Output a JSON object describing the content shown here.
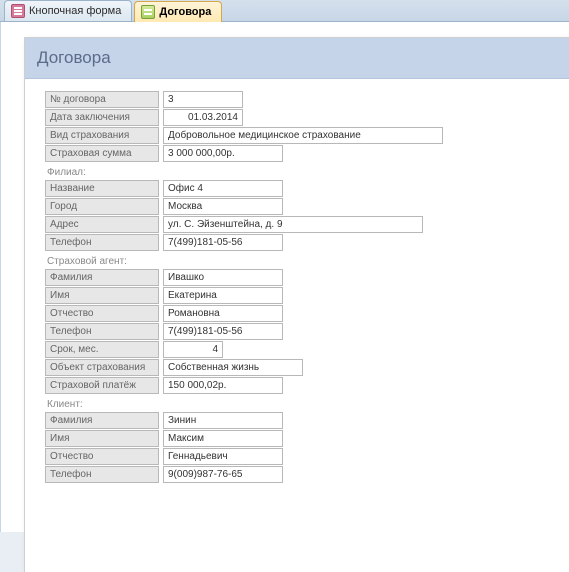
{
  "tabs": {
    "inactive": "Кнопочная форма",
    "active": "Договора"
  },
  "title": "Договора",
  "fields": {
    "contract_no_label": "№ договора",
    "contract_no": "3",
    "date_label": "Дата заключения",
    "date": "01.03.2014",
    "ins_type_label": "Вид страхования",
    "ins_type": "Добровольное медицинское страхование",
    "ins_sum_label": "Страховая сумма",
    "ins_sum": "3 000 000,00р."
  },
  "branch": {
    "section": "Филиал:",
    "name_label": "Название",
    "name": "Офис 4",
    "city_label": "Город",
    "city": "Москва",
    "addr_label": "Адрес",
    "addr": "ул. С. Эйзенштейна, д. 9",
    "phone_label": "Телефон",
    "phone": "7(499)181-05-56"
  },
  "agent": {
    "section": "Страховой агент:",
    "lname_label": "Фамилия",
    "lname": "Ивашко",
    "fname_label": "Имя",
    "fname": "Екатерина",
    "mname_label": "Отчество",
    "mname": "Романовна",
    "phone_label": "Телефон",
    "phone": "7(499)181-05-56",
    "term_label": "Срок, мес.",
    "term": "4",
    "object_label": "Объект страхования",
    "object": "Собственная жизнь",
    "payment_label": "Страховой платёж",
    "payment": "150 000,02р."
  },
  "client": {
    "section": "Клиент:",
    "lname_label": "Фамилия",
    "lname": "Зинин",
    "fname_label": "Имя",
    "fname": "Максим",
    "mname_label": "Отчество",
    "mname": "Геннадьевич",
    "phone_label": "Телефон",
    "phone": "9(009)987-76-65"
  }
}
